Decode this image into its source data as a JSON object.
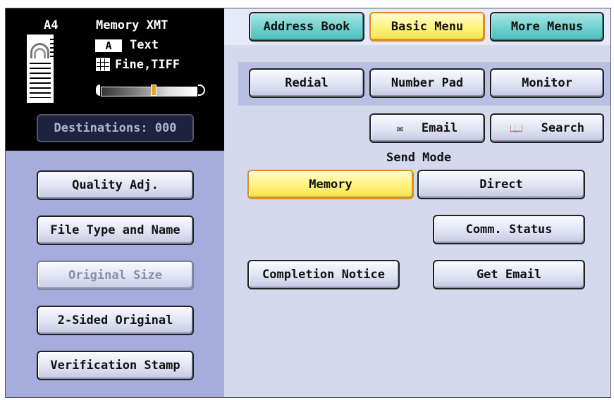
{
  "status": {
    "paper_size": "A4",
    "mode_title": "Memory XMT",
    "text_mode_badge": "A",
    "text_mode_label": "Text",
    "resolution_label": "Fine,TIFF",
    "density_level": 0.55,
    "destinations": "Destinations: 000"
  },
  "tabs": {
    "address_book": "Address Book",
    "basic_menu": "Basic Menu",
    "more_menus": "More Menus",
    "active": "Basic Menu"
  },
  "top_row": {
    "redial": "Redial",
    "number_pad": "Number Pad",
    "monitor": "Monitor"
  },
  "search_row": {
    "email": "Email",
    "email_icon": "envelope-icon",
    "search": "Search",
    "search_icon": "book-icon"
  },
  "send_mode": {
    "title": "Send Mode",
    "memory": "Memory",
    "direct": "Direct",
    "selected": "Memory"
  },
  "actions": {
    "comm_status": "Comm. Status",
    "completion_notice": "Completion Notice",
    "get_email": "Get Email"
  },
  "sidebar": {
    "items": [
      {
        "label": "Quality Adj.",
        "enabled": true
      },
      {
        "label": "File Type and Name",
        "enabled": true
      },
      {
        "label": "Original Size",
        "enabled": false
      },
      {
        "label": "2-Sided Original",
        "enabled": true
      },
      {
        "label": "Verification Stamp",
        "enabled": true
      }
    ]
  },
  "colors": {
    "tab_teal": "#6fd0cf",
    "selected_yellow": "#fff37a",
    "left_panel": "#a6acdb",
    "status_bg": "#000000"
  }
}
